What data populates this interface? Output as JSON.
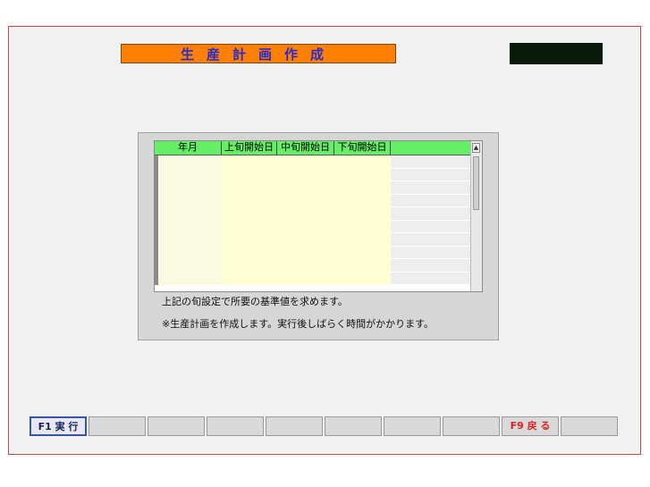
{
  "title": "生産計画作成",
  "clock": "",
  "grid": {
    "headers": [
      "年月",
      "上旬開始日",
      "中旬開始日",
      "下旬開始日",
      ""
    ],
    "rows": [
      [
        "",
        "",
        "",
        ""
      ],
      [
        "",
        "",
        "",
        ""
      ],
      [
        "",
        "",
        "",
        ""
      ],
      [
        "",
        "",
        "",
        ""
      ],
      [
        "",
        "",
        "",
        ""
      ],
      [
        "",
        "",
        "",
        ""
      ],
      [
        "",
        "",
        "",
        ""
      ],
      [
        "",
        "",
        "",
        ""
      ],
      [
        "",
        "",
        "",
        ""
      ],
      [
        "",
        "",
        "",
        ""
      ]
    ]
  },
  "notes": {
    "line1": "上記の旬設定で所要の基準値を求めます。",
    "line2": "※生産計画を作成します。実行後しばらく時間がかかります。"
  },
  "function_keys": [
    "F1 実 行",
    "",
    "",
    "",
    "",
    "",
    "",
    "",
    "F9 戻 る",
    ""
  ]
}
